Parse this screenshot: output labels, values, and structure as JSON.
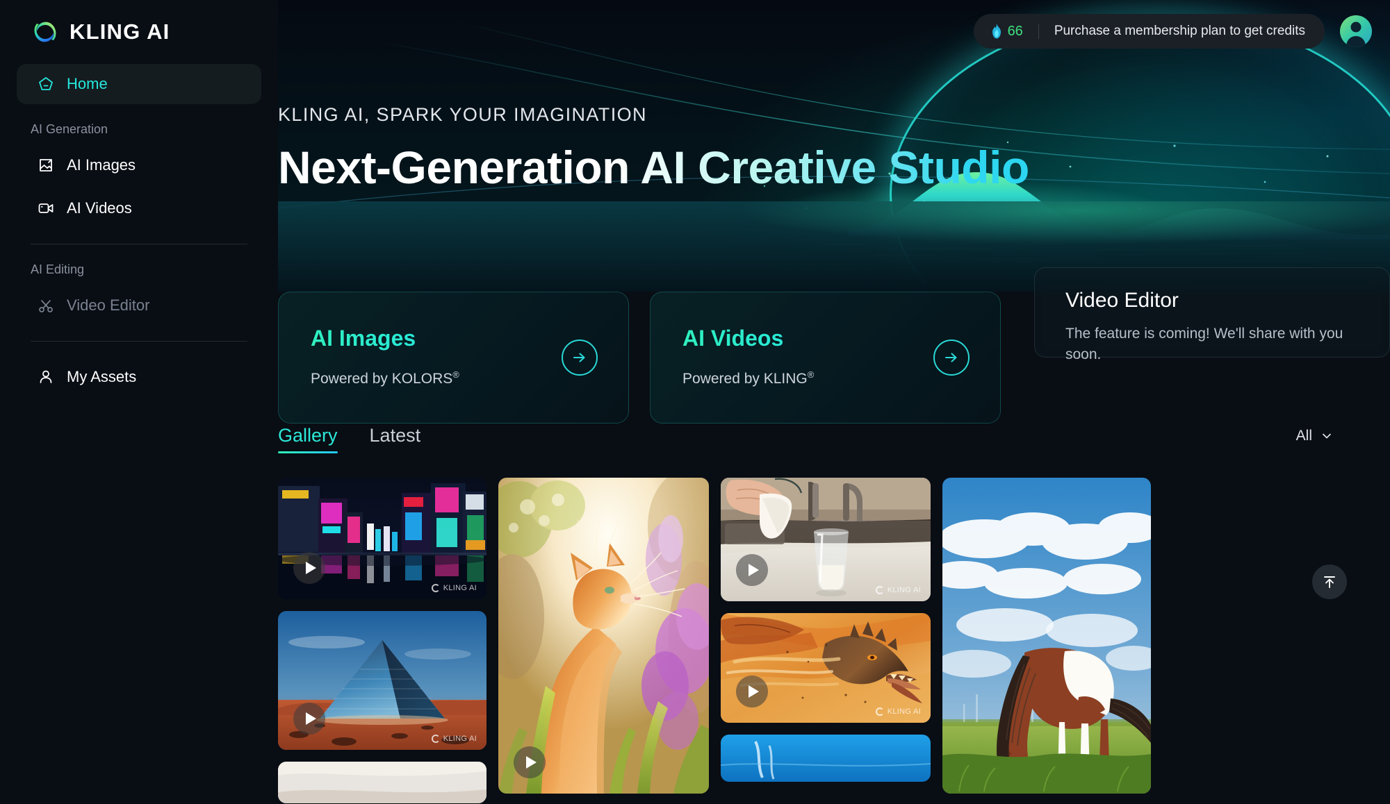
{
  "brand": {
    "name": "KLING AI",
    "logo_icon": "kling-infinity-logo"
  },
  "header": {
    "credits": "66",
    "credits_icon": "flame-icon",
    "purchase_text": "Purchase a membership plan to get credits",
    "avatar_icon": "user-avatar"
  },
  "sidebar": {
    "home": {
      "label": "Home",
      "icon": "home-pentagon-icon"
    },
    "sections": [
      {
        "title": "AI Generation",
        "items": [
          {
            "label": "AI Images",
            "icon": "image-icon",
            "disabled": false
          },
          {
            "label": "AI Videos",
            "icon": "video-camera-icon",
            "disabled": false
          }
        ]
      },
      {
        "title": "AI Editing",
        "items": [
          {
            "label": "Video Editor",
            "icon": "scissors-icon",
            "disabled": true
          }
        ]
      }
    ],
    "assets": {
      "label": "My Assets",
      "icon": "person-icon"
    }
  },
  "hero": {
    "kicker": "KLING AI, SPARK YOUR IMAGINATION",
    "title": "Next-Generation AI Creative Studio"
  },
  "feature_cards": [
    {
      "title": "AI Images",
      "subtitle": "Powered by KOLORS",
      "trademark": "®",
      "arrow_icon": "arrow-right-icon"
    },
    {
      "title": "AI Videos",
      "subtitle": "Powered by KLING",
      "trademark": "®",
      "arrow_icon": "arrow-right-icon"
    }
  ],
  "video_editor_card": {
    "title": "Video Editor",
    "description": "The feature is coming! We'll share with you soon."
  },
  "gallery": {
    "tabs": [
      {
        "label": "Gallery",
        "active": true
      },
      {
        "label": "Latest",
        "active": false
      }
    ],
    "filter": {
      "value": "All",
      "icon": "chevron-down-icon"
    },
    "watermark_text": "KLING AI",
    "items": [
      {
        "alt": "Neon cyberpunk city street at night with reflections",
        "has_play": true,
        "has_watermark": true
      },
      {
        "alt": "Glass pyramid in red desert under blue sky",
        "has_play": true,
        "has_watermark": true
      },
      {
        "alt": "Sunlit beach wave",
        "has_play": false,
        "has_watermark": false
      },
      {
        "alt": "Orange tabby cat looking up in backlit garden with purple flowers",
        "has_play": true,
        "has_watermark": false
      },
      {
        "alt": "Hand pouring milk into glass by kitchen sink",
        "has_play": true,
        "has_watermark": true
      },
      {
        "alt": "Roaring dragon in golden sandstorm",
        "has_play": true,
        "has_watermark": true
      },
      {
        "alt": "Blue ocean water surface",
        "has_play": false,
        "has_watermark": false
      },
      {
        "alt": "Pinto horse grazing in green field under cloudy blue sky",
        "has_play": false,
        "has_watermark": false
      }
    ],
    "scroll_top_icon": "arrow-up-icon"
  },
  "colors": {
    "accent_cyan": "#2ce9d8",
    "accent_green": "#3ee07f",
    "background": "#090d14",
    "sidebar_active": "#141c1f"
  }
}
